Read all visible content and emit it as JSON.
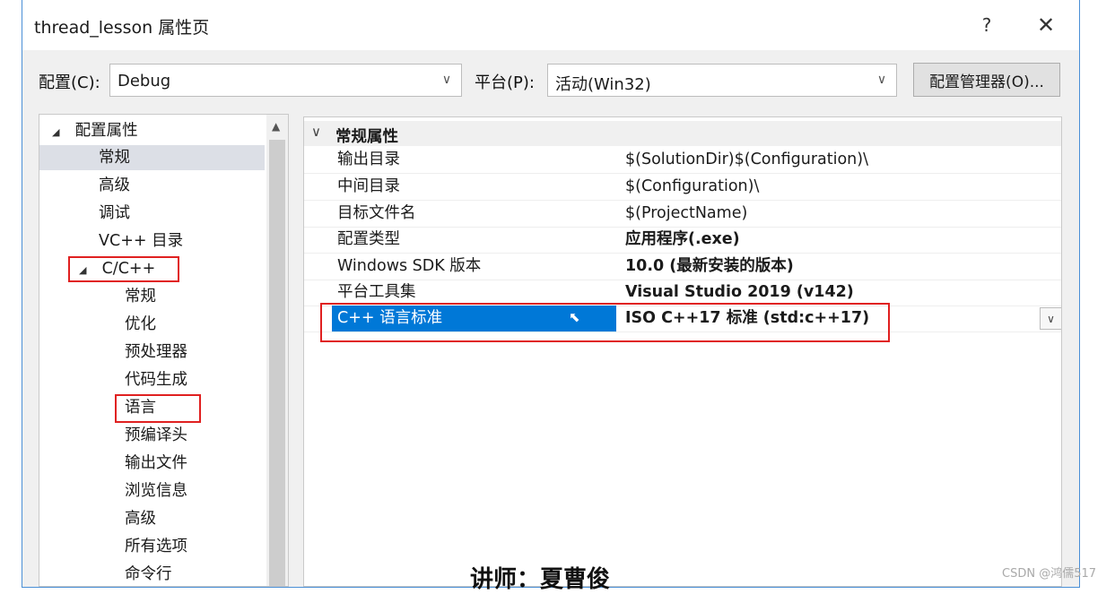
{
  "window": {
    "title": "thread_lesson 属性页",
    "help_glyph": "?",
    "close_glyph": "✕"
  },
  "toolbar": {
    "config_label": "配置(C):",
    "config_value": "Debug",
    "platform_label": "平台(P):",
    "platform_value": "活动(Win32)",
    "manager_button": "配置管理器(O)..."
  },
  "tree": {
    "items": [
      {
        "label": "配置属性",
        "glyph": "◢",
        "level": 0,
        "selected": false
      },
      {
        "label": "常规",
        "level": 1,
        "selected": true
      },
      {
        "label": "高级",
        "level": 1,
        "selected": false
      },
      {
        "label": "调试",
        "level": 1,
        "selected": false
      },
      {
        "label": "VC++ 目录",
        "level": 1,
        "selected": false
      },
      {
        "label": "C/C++",
        "glyph": "◢",
        "level": 1,
        "selected": false
      },
      {
        "label": "常规",
        "level": 2,
        "selected": false
      },
      {
        "label": "优化",
        "level": 2,
        "selected": false
      },
      {
        "label": "预处理器",
        "level": 2,
        "selected": false
      },
      {
        "label": "代码生成",
        "level": 2,
        "selected": false
      },
      {
        "label": "语言",
        "level": 2,
        "selected": false
      },
      {
        "label": "预编译头",
        "level": 2,
        "selected": false
      },
      {
        "label": "输出文件",
        "level": 2,
        "selected": false
      },
      {
        "label": "浏览信息",
        "level": 2,
        "selected": false
      },
      {
        "label": "高级",
        "level": 2,
        "selected": false
      },
      {
        "label": "所有选项",
        "level": 2,
        "selected": false
      },
      {
        "label": "命令行",
        "level": 2,
        "selected": false
      }
    ],
    "scroll_up_glyph": "▲"
  },
  "grid": {
    "category": "常规属性",
    "category_chevron": "∨",
    "rows": [
      {
        "name": "输出目录",
        "value": "$(SolutionDir)$(Configuration)\\",
        "bold": false
      },
      {
        "name": "中间目录",
        "value": "$(Configuration)\\",
        "bold": false
      },
      {
        "name": "目标文件名",
        "value": "$(ProjectName)",
        "bold": false
      },
      {
        "name": "配置类型",
        "value": "应用程序(.exe)",
        "bold": true
      },
      {
        "name": "Windows SDK 版本",
        "value": "10.0 (最新安装的版本)",
        "bold": true
      },
      {
        "name": "平台工具集",
        "value": "Visual Studio 2019 (v142)",
        "bold": true
      },
      {
        "name": "C++ 语言标准",
        "value": "ISO C++17 标准 (std:c++17)",
        "bold": true
      }
    ],
    "selected_row": 6,
    "dropdown_glyph": "∨"
  },
  "overlay": {
    "instructor": "讲师：夏曹俊"
  },
  "watermark": "CSDN @鸿儒517",
  "colors": {
    "selection": "#0078d7",
    "highlight_box": "#e02020",
    "dialog_bg": "#f0f0f0"
  }
}
